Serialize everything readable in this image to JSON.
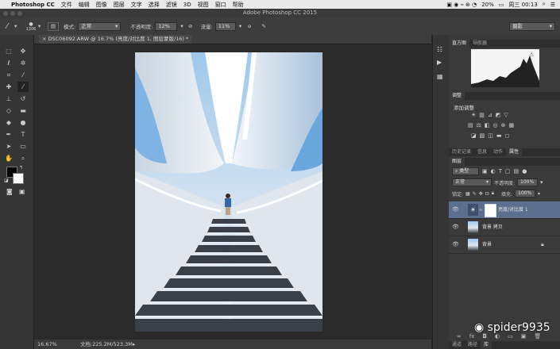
{
  "menubar": {
    "app": "Photoshop CC",
    "items": [
      "文件",
      "编辑",
      "图像",
      "图层",
      "文字",
      "选择",
      "滤镜",
      "3D",
      "视图",
      "窗口",
      "帮助"
    ],
    "battery": "20%",
    "clock": "周三 00:13"
  },
  "window": {
    "title": "Adobe Photoshop CC 2015"
  },
  "options": {
    "brush_size": "1306",
    "mode_label": "模式:",
    "mode_value": "正常",
    "opacity_label": "不透明度:",
    "opacity_value": "12%",
    "flow_label": "流量:",
    "flow_value": "11%",
    "workspace": "摄影"
  },
  "document": {
    "tab": "DSC06092.ARW @ 16.7% (亮度/对比度 1, 图层蒙版/16) *",
    "zoom": "16.67%",
    "doc_info": "文档:225.2M/523.3M"
  },
  "panels": {
    "top_tabs": [
      "直方图",
      "导航器"
    ],
    "adjust_tab": "调整",
    "adjust_title": "添加调整",
    "mid_tabs": [
      "历史记录",
      "信息",
      "动作",
      "属性"
    ],
    "layers_tab": "图层",
    "filter_kind": "类型",
    "blend_mode": "正常",
    "opacity_label": "不透明度:",
    "opacity_value": "100%",
    "lock_label": "锁定:",
    "fill_label": "填充:",
    "fill_value": "100%",
    "layers": [
      {
        "name": "亮度/对比度 1"
      },
      {
        "name": "背景 拷贝"
      },
      {
        "name": "背景"
      }
    ],
    "bottom_tabs": [
      "通道",
      "路径",
      "库"
    ]
  },
  "watermark": "spider9935",
  "colors": {
    "accent": "#59a5e8",
    "selected_layer": "#5c6f8e"
  }
}
